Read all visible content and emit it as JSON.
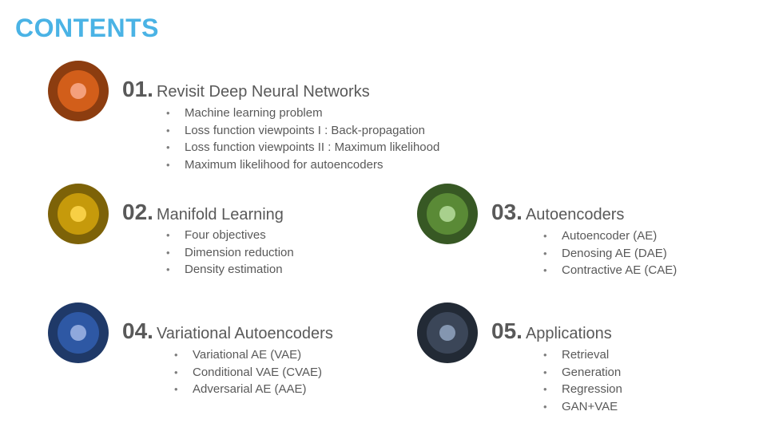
{
  "title": "CONTENTS",
  "colors": {
    "title": "#4ab3e5",
    "text": "#595959"
  },
  "sections": [
    {
      "number": "01.",
      "label": "Revisit Deep Neural Networks",
      "badge_colors": [
        "#8c3d10",
        "#d25e1a",
        "#f4a07c"
      ],
      "items": [
        "Machine learning problem",
        "Loss function viewpoints I : Back-propagation",
        "Loss function viewpoints II : Maximum likelihood",
        "Maximum likelihood for autoencoders"
      ]
    },
    {
      "number": "02.",
      "label": "Manifold Learning",
      "badge_colors": [
        "#7d6208",
        "#c69a0b",
        "#f7cf45"
      ],
      "items": [
        "Four objectives",
        "Dimension reduction",
        "Density estimation"
      ]
    },
    {
      "number": "03.",
      "label": "Autoencoders",
      "badge_colors": [
        "#375824",
        "#5a8a36",
        "#a8d08d"
      ],
      "items": [
        "Autoencoder (AE)",
        "Denosing AE (DAE)",
        "Contractive AE (CAE)"
      ]
    },
    {
      "number": "04.",
      "label": "Variational Autoencoders",
      "badge_colors": [
        "#1f3968",
        "#2e58a4",
        "#8fa8dc"
      ],
      "items": [
        "Variational AE (VAE)",
        "Conditional VAE (CVAE)",
        "Adversarial AE (AAE)"
      ]
    },
    {
      "number": "05.",
      "label": "Applications",
      "badge_colors": [
        "#222a35",
        "#3b4658",
        "#8496b0"
      ],
      "items": [
        "Retrieval",
        "Generation",
        "Regression",
        "GAN+VAE"
      ]
    }
  ]
}
